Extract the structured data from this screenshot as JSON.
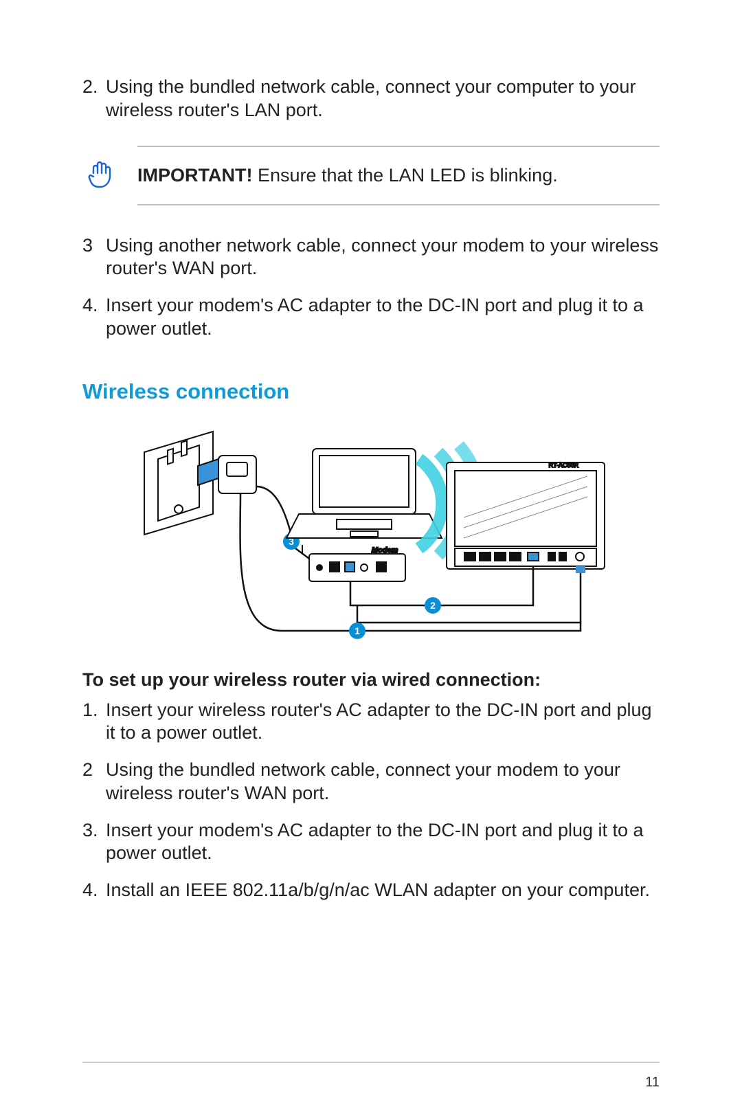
{
  "top_list": [
    {
      "num": "2.",
      "text": "Using the bundled network cable, connect your computer to your wireless router's LAN port."
    }
  ],
  "callout": {
    "bold": "IMPORTANT!",
    "text": "  Ensure that the LAN LED is blinking."
  },
  "mid_list": [
    {
      "num": "3",
      "text": "Using another network cable, connect your modem to your wireless router's WAN port."
    },
    {
      "num": "4.",
      "text": "Insert your modem's AC adapter to the DC-IN port and plug it to a power outlet."
    }
  ],
  "section_title": "Wireless connection",
  "diagram": {
    "router_model": "RT-AC56R",
    "modem_label": "Modem",
    "badges": [
      "1",
      "2",
      "3"
    ]
  },
  "subhead": "To set up your wireless router via wired connection:",
  "bottom_list": [
    {
      "num": "1.",
      "text": "Insert your wireless router's AC adapter to the DC-IN port and plug it to a power outlet."
    },
    {
      "num": "2",
      "text": "Using the bundled network cable, connect your modem to your wireless router's WAN port."
    },
    {
      "num": "3.",
      "text": "Insert your modem's AC adapter to the DC-IN port and plug it to a power outlet."
    },
    {
      "num": "4.",
      "text": "Install an IEEE 802.11a/b/g/n/ac WLAN adapter on your computer."
    }
  ],
  "page_num": "11"
}
